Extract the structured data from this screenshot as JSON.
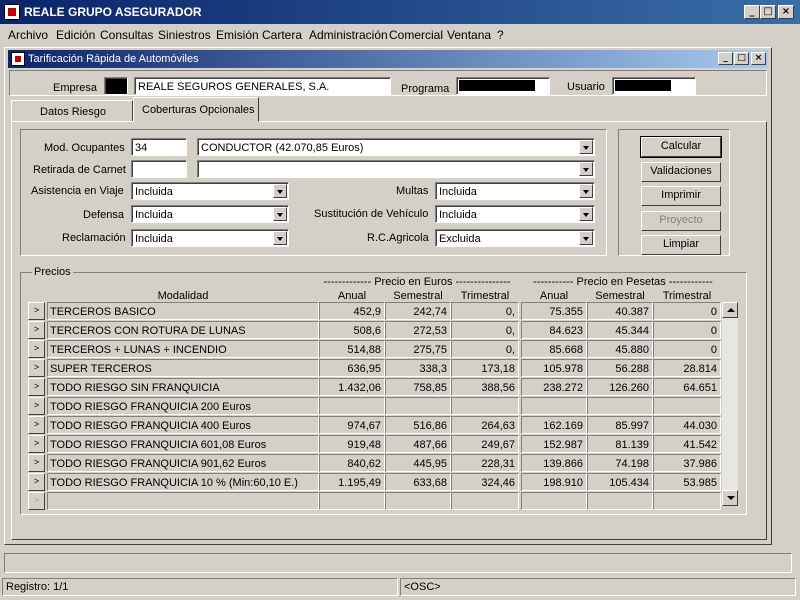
{
  "app": {
    "title": "REALE GRUPO ASEGURADOR"
  },
  "menu": [
    "Archivo",
    "Edición",
    "Consultas",
    "Siniestros",
    "Emisión",
    "Cartera",
    "Administración",
    "Comercial",
    "Ventana",
    "?"
  ],
  "window": {
    "title": "Tarificación Rápida de Automóviles"
  },
  "header": {
    "empresa_label": "Empresa",
    "empresa_value": "REALE SEGUROS GENERALES, S.A.",
    "programa_label": "Programa",
    "usuario_label": "Usuario"
  },
  "tabs": {
    "datos_riesgo": "Datos Riesgo",
    "coberturas": "Coberturas Opcionales"
  },
  "form": {
    "mod_ocupantes_label": "Mod. Ocupantes",
    "mod_ocupantes_value": "34",
    "mod_ocupantes_desc": "CONDUCTOR (42.070,85  Euros)",
    "retirada_label": "Retirada de Carnet",
    "asistencia_label": "Asistencia en Viaje",
    "asistencia_value": "Incluida",
    "defensa_label": "Defensa",
    "defensa_value": "Incluida",
    "reclamacion_label": "Reclamación",
    "reclamacion_value": "Incluida",
    "multas_label": "Multas",
    "multas_value": "Incluida",
    "sustitucion_label": "Sustitución de Vehículo",
    "sustitucion_value": "Incluida",
    "rc_label": "R.C.Agricola",
    "rc_value": "Excluida"
  },
  "buttons": {
    "calcular": "Calcular",
    "validaciones": "Validaciones",
    "imprimir": "Imprimir",
    "proyecto": "Proyecto",
    "limpiar": "Limpiar"
  },
  "precios": {
    "group_label": "Precios",
    "euros_header": "------------- Precio en Euros ---------------",
    "pesetas_header": "----------- Precio en Pesetas ------------",
    "col_modalidad": "Modalidad",
    "col_anual": "Anual",
    "col_semestral": "Semestral",
    "col_trimestral": "Trimestral",
    "row_marker": ">",
    "rows": [
      {
        "modalidad": "TERCEROS BASICO",
        "e_anual": "452,9",
        "e_sem": "242,74",
        "e_tri": "0,",
        "p_anual": "75.355",
        "p_sem": "40.387",
        "p_tri": "0"
      },
      {
        "modalidad": "TERCEROS CON ROTURA DE LUNAS",
        "e_anual": "508,6",
        "e_sem": "272,53",
        "e_tri": "0,",
        "p_anual": "84.623",
        "p_sem": "45.344",
        "p_tri": "0"
      },
      {
        "modalidad": "TERCEROS + LUNAS + INCENDIO",
        "e_anual": "514,88",
        "e_sem": "275,75",
        "e_tri": "0,",
        "p_anual": "85.668",
        "p_sem": "45.880",
        "p_tri": "0"
      },
      {
        "modalidad": "SUPER TERCEROS",
        "e_anual": "636,95",
        "e_sem": "338,3",
        "e_tri": "173,18",
        "p_anual": "105.978",
        "p_sem": "56.288",
        "p_tri": "28.814"
      },
      {
        "modalidad": "TODO RIESGO SIN FRANQUICIA",
        "e_anual": "1.432,06",
        "e_sem": "758,85",
        "e_tri": "388,56",
        "p_anual": "238.272",
        "p_sem": "126.260",
        "p_tri": "64.651"
      },
      {
        "modalidad": "TODO RIESGO FRANQUICIA 200 Euros",
        "e_anual": "",
        "e_sem": "",
        "e_tri": "",
        "p_anual": "",
        "p_sem": "",
        "p_tri": ""
      },
      {
        "modalidad": "TODO RIESGO FRANQUICIA 400 Euros",
        "e_anual": "974,67",
        "e_sem": "516,86",
        "e_tri": "264,63",
        "p_anual": "162.169",
        "p_sem": "85.997",
        "p_tri": "44.030"
      },
      {
        "modalidad": "TODO RIESGO FRANQUICIA 601,08 Euros",
        "e_anual": "919,48",
        "e_sem": "487,66",
        "e_tri": "249,67",
        "p_anual": "152.987",
        "p_sem": "81.139",
        "p_tri": "41.542"
      },
      {
        "modalidad": "TODO RIESGO FRANQUICIA 901,62 Euros",
        "e_anual": "840,62",
        "e_sem": "445,95",
        "e_tri": "228,31",
        "p_anual": "139.866",
        "p_sem": "74.198",
        "p_tri": "37.986"
      },
      {
        "modalidad": "TODO RIESGO FRANQUICIA 10 % (Min:60,10 E.)",
        "e_anual": "1.195,49",
        "e_sem": "633,68",
        "e_tri": "324,46",
        "p_anual": "198.910",
        "p_sem": "105.434",
        "p_tri": "53.985"
      },
      {
        "modalidad": "",
        "e_anual": "",
        "e_sem": "",
        "e_tri": "",
        "p_anual": "",
        "p_sem": "",
        "p_tri": ""
      }
    ]
  },
  "status": {
    "registro": "Registro: 1/1",
    "osc": "<OSC>"
  }
}
